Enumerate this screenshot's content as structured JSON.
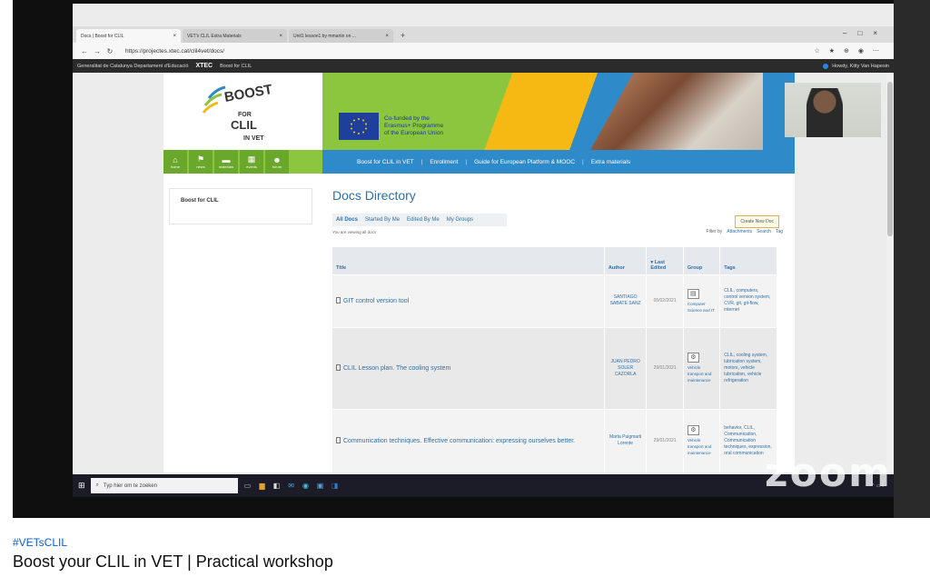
{
  "browser": {
    "tabs": [
      {
        "label": "Docs | Boost for CLIL",
        "active": true
      },
      {
        "label": "VET's CLIL Extra Materials",
        "active": false
      },
      {
        "label": "Unit1 lesson1 by mmartin on ...",
        "active": false
      }
    ],
    "new_tab": "+",
    "url": "https://projectes.xtec.cat/clil4vet/docs/"
  },
  "gencat_bar": {
    "org": "Generalitat de Catalunya Departament d'Educació",
    "xtec": "XTEC",
    "site": "Boost for CLIL",
    "howdy": "Howdy, Kitty Van Hapesin"
  },
  "banner": {
    "logo_boost": "BOOST",
    "logo_for": "FOR",
    "logo_clil": "CLIL",
    "logo_invet": "IN VET",
    "eu_text": [
      "Co-funded by the",
      "Erasmus+ Programme",
      "of the European Union"
    ]
  },
  "icon_nav": [
    {
      "icon": "home-icon",
      "label": "home"
    },
    {
      "icon": "news-icon",
      "label": "news"
    },
    {
      "icon": "materials-icon",
      "label": "materials"
    },
    {
      "icon": "events-icon",
      "label": "events"
    },
    {
      "icon": "forum-icon",
      "label": "forum"
    }
  ],
  "text_nav": [
    "Boost for CLIL in VET",
    "Enrollment",
    "Guide for European Platform & MOOC",
    "Extra materials"
  ],
  "text_nav_sep": "|",
  "sidebar": {
    "title": "Boost for CLIL"
  },
  "docs": {
    "title": "Docs Directory",
    "subnav": [
      "All Docs",
      "Started By Me",
      "Edited By Me",
      "My Groups"
    ],
    "create_button": "Create New Doc",
    "viewing": "You are viewing all docs",
    "filter_label": "Filter by",
    "filter_links": [
      "Attachments",
      "Search",
      "Tag"
    ],
    "columns": {
      "title": "Title",
      "author": "Author",
      "last_edited": "▾ Last Edited",
      "group": "Group",
      "tags": "Tags"
    },
    "rows": [
      {
        "title": "GIT control version tool",
        "author": "SANTIAGO SABATE SANZ",
        "date": "05/02/2021",
        "group": "Computer Science and IT",
        "tags": "CLIL, computers, control version system, CVR, git, git-flow, internet"
      },
      {
        "title": "CLIL Lesson plan. The cooling system",
        "author": "JUAN PEDRO SOLER CAZORLA",
        "date": "29/01/2021",
        "group": "Vehicle transport and maintenance",
        "tags": "CLIL, cooling system, lubrication system, motors, vehicle lubrication, vehicle refrigeration"
      },
      {
        "title": "Communication techniques. Effective communication: expressing ourselves better.",
        "author": "Marta Puigmarti Lorente",
        "date": "29/01/2021",
        "group": "Vehicle transport and maintenance",
        "tags": "behavior, CLIL, Communication, Communication techniques, expression, oral communication"
      }
    ]
  },
  "taskbar": {
    "search_placeholder": "Typ hier om te zoeken"
  },
  "watermark": "zoom",
  "video": {
    "hashtag": "#VETsCLIL",
    "title": "Boost your CLIL in VET | Practical workshop"
  }
}
